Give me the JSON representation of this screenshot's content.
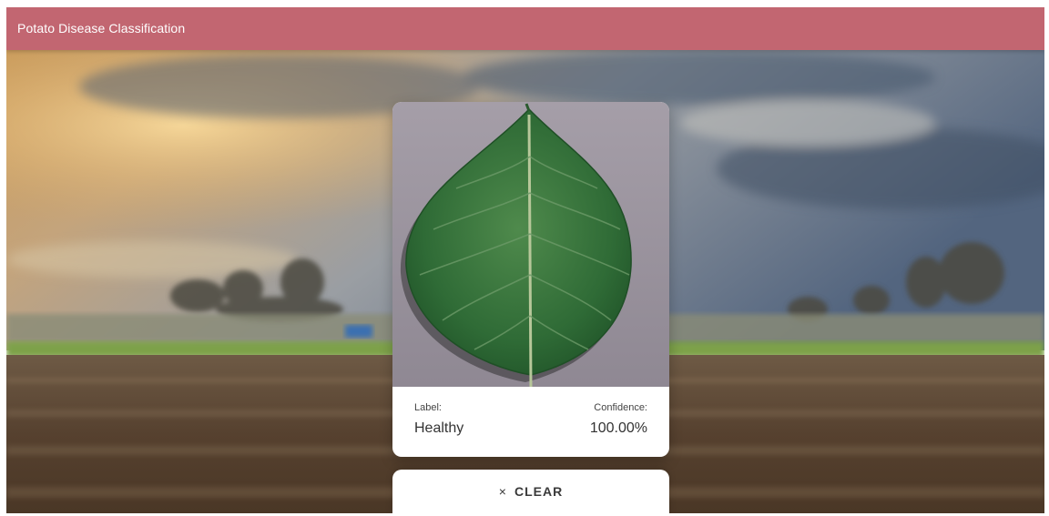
{
  "app_bar": {
    "title": "Potato Disease Classification",
    "color": "#c26671"
  },
  "background": {
    "description_icon": "landscape-image"
  },
  "result_card": {
    "image_icon": "potato-leaf-image",
    "label_key": "Label:",
    "label_value": "Healthy",
    "confidence_key": "Confidence:",
    "confidence_value": "100.00%"
  },
  "clear_button": {
    "icon": "close-icon",
    "icon_glyph": "×",
    "label": "CLEAR"
  }
}
